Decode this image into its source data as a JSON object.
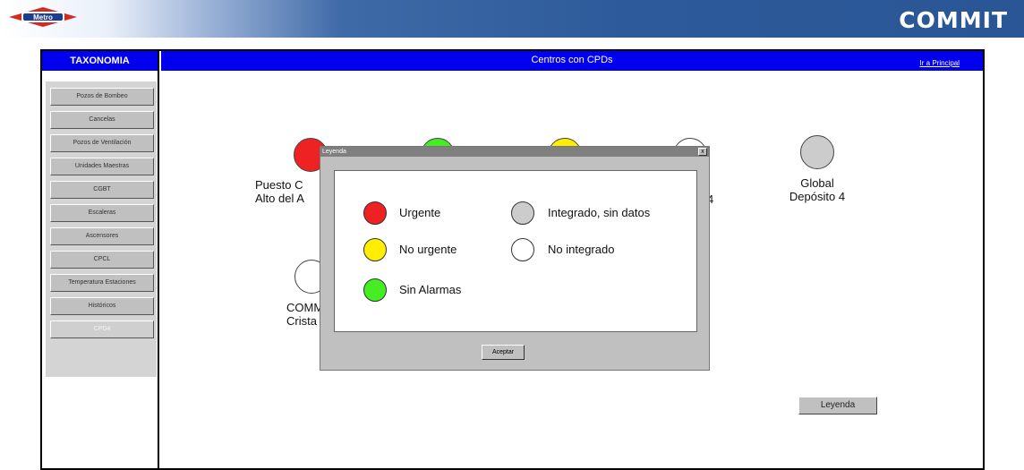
{
  "header": {
    "metro_logo": "Metro",
    "commit_logo": "COMMIT"
  },
  "nav": {
    "section_title": "TAXONOMIA",
    "page_title": "Centros con CPDs",
    "principal_link": "Ir a Principal",
    "menu": [
      {
        "label": "Pozos de Bombeo",
        "disabled": false
      },
      {
        "label": "Cancelas",
        "disabled": false
      },
      {
        "label": "Pozos de Ventilación",
        "disabled": false
      },
      {
        "label": "Unidades Maestras",
        "disabled": false
      },
      {
        "label": "CGBT",
        "disabled": false
      },
      {
        "label": "Escaleras",
        "disabled": false
      },
      {
        "label": "Ascensores",
        "disabled": false
      },
      {
        "label": "CPCL",
        "disabled": false
      },
      {
        "label": "Temperatura Estaciones",
        "disabled": false
      },
      {
        "label": "Históricos",
        "disabled": false
      },
      {
        "label": "CPD4",
        "disabled": true
      }
    ]
  },
  "centers": [
    {
      "line1": "Puesto C",
      "line2": "Alto del A",
      "status": "urgente"
    },
    {
      "line1": "",
      "line2": "",
      "status": "sin_alarmas"
    },
    {
      "line1": "",
      "line2": "",
      "status": "no_urgente"
    },
    {
      "line1": "4",
      "line2": "",
      "status": "no_integrado"
    },
    {
      "line1": "Global",
      "line2": "Depósito 4",
      "status": "integrado_sin_datos"
    },
    {
      "line1": "COMM",
      "line2": "Crista",
      "status": "no_integrado"
    }
  ],
  "legend_button_label": "Leyenda",
  "dialog": {
    "title": "Leyenda",
    "close_glyph": "x",
    "accept_label": "Aceptar",
    "items": [
      {
        "label": "Urgente",
        "color": "#ee2222"
      },
      {
        "label": "No urgente",
        "color": "#ffee00"
      },
      {
        "label": "Sin Alarmas",
        "color": "#44ee22"
      },
      {
        "label": "Integrado, sin datos",
        "color": "#cccccc"
      },
      {
        "label": "No integrado",
        "color": "#ffffff"
      }
    ]
  },
  "colors": {
    "header_blue": "#0000ee",
    "urgente": "#ee2222",
    "no_urgente": "#ffee00",
    "sin_alarmas": "#44ee22",
    "integrado_sin_datos": "#cccccc",
    "no_integrado": "#ffffff"
  }
}
